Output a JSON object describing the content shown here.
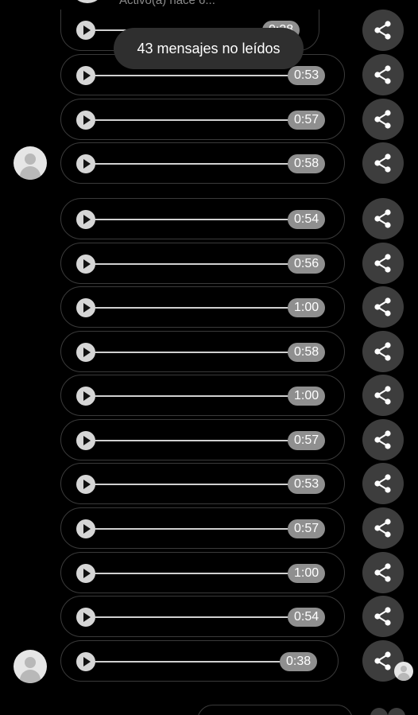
{
  "header": {
    "status_text": "Activo(a) hace 6..."
  },
  "toast": {
    "label": "43 mensajes no leídos"
  },
  "messages": [
    {
      "duration": "0:38"
    },
    {
      "duration": "0:53"
    },
    {
      "duration": "0:57"
    },
    {
      "duration": "0:58"
    },
    {
      "duration": "0:54"
    },
    {
      "duration": "0:56"
    },
    {
      "duration": "1:00"
    },
    {
      "duration": "0:58"
    },
    {
      "duration": "1:00"
    },
    {
      "duration": "0:57"
    },
    {
      "duration": "0:53"
    },
    {
      "duration": "0:57"
    },
    {
      "duration": "1:00"
    },
    {
      "duration": "0:54"
    },
    {
      "duration": "0:38"
    }
  ],
  "icons": {
    "play": "play-icon",
    "share": "share-icon",
    "avatar": "user-avatar-icon"
  },
  "colors": {
    "background": "#000000",
    "bubble_border": "#3a3a3a",
    "duration_pill": "#8f8f8f",
    "share_button": "#3d3d3d",
    "toast": "#2f2f2f"
  }
}
